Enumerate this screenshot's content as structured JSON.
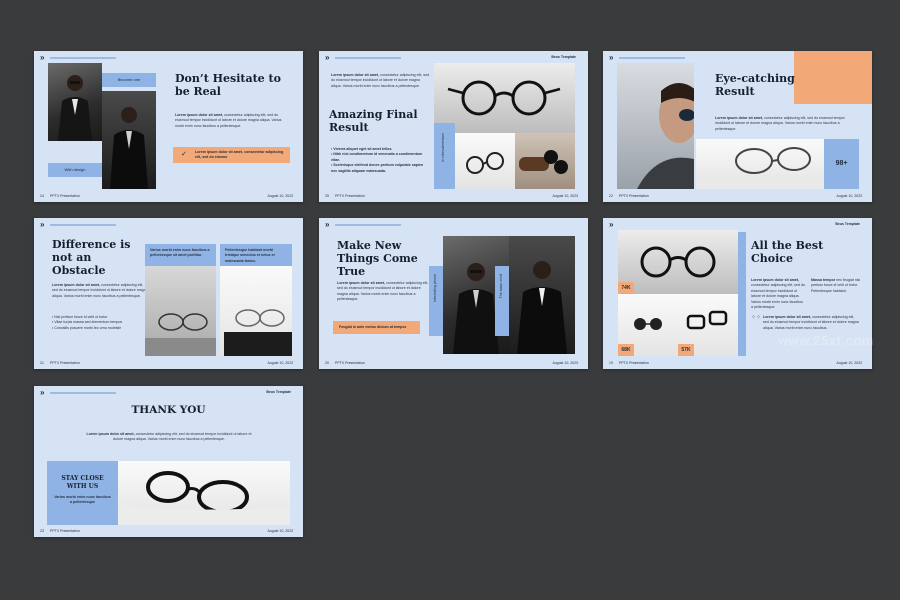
{
  "common": {
    "chevron": "»",
    "brand": "Beus Template",
    "presentation": "PPTX Presentation",
    "date": "August 10, 2023",
    "lorem_short": "Lorem ipsum dolor sit amet,",
    "lorem_rest": " consectetur adipiscing elit, sed do eiusmod tempor incididunt ut labore et dolore magna aliqua. Varius morbi enim nunc faucibus a pellentesque."
  },
  "slides": [
    {
      "page": "24",
      "title": "Don’t Hesitate to be Real",
      "tag_top": "Become one",
      "tag_bottom": "With design",
      "callout": "Lorem ipsum dolor sit amet, consectetur adipiscing elit, sed do eiusmo"
    },
    {
      "page": "25",
      "title": "Amazing Final Result",
      "bullets": [
        "Viverra aliquet eget sit amet tellus.",
        "Nibh nisl condimentum id venenatis a condimentum vitae.",
        "Scelerisque eleifend donec pretium vulputate sapien nec sagittis aliquam malesuada."
      ],
      "vlabel": "In intervalmentum"
    },
    {
      "page": "22",
      "title": "Eye-catching Result",
      "badge": "98+"
    },
    {
      "page": "21",
      "title": "Difference is not an Obstacle",
      "card1": "Varius morbi enim nunc faucibus a pellentesque sit amet porttitor.",
      "card2": "Pellentesque habitant morbi tristique senectus et netus et malesuada fames.",
      "bullets": [
        "Nisl pretium fusce id velit ut tortor",
        "Vitae turpis massa sed elementum tempus",
        "Convallis posuere morbi leo urna molestie"
      ]
    },
    {
      "page": "20",
      "title": "Make New Things Come True",
      "callout": "Feugiat in ante metus dictum at tempor",
      "vlabel1": "Interesting phone",
      "vlabel2": "The basic mind"
    },
    {
      "page": "19",
      "title": "All the Best Choice",
      "stats": [
        "74K",
        "68K",
        "57K"
      ],
      "col2_head": "Massa tempor",
      "col2_body": "nec feugiat nisl pretium fusce id velit ut tortor. Pellentesque habitant.",
      "body2_head": "Lorem ipsum dolor sit amet,",
      "body2_rest": " consectetur adipiscing elit, sed do eiusmod tempor incididunt ut labore et dolore magna aliqua. Varius morbi enim nunc faucibus."
    },
    {
      "page": "23",
      "title": "THANK YOU",
      "stay": "STAY CLOSE WITH US",
      "stay_sub": "Varius morbi enim nunc faucibus a pellentesque"
    }
  ],
  "watermark": "www.25xt.com"
}
